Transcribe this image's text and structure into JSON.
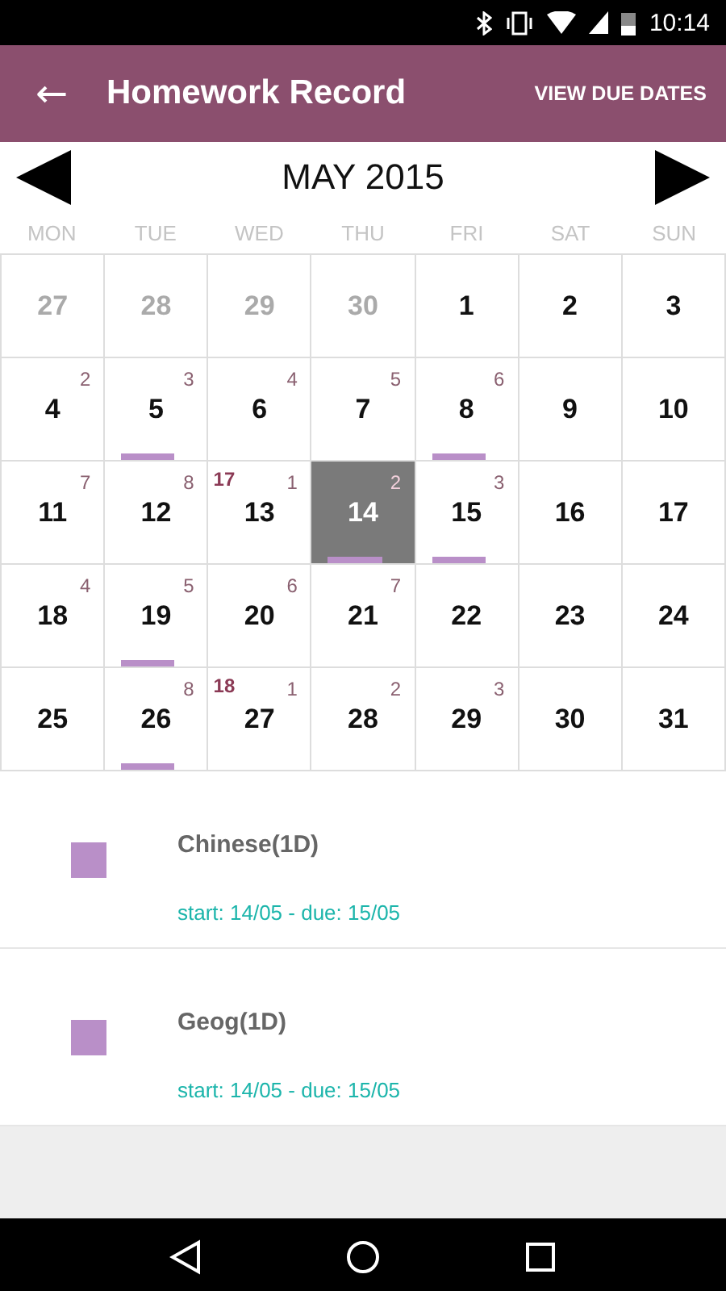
{
  "status_bar": {
    "time": "10:14"
  },
  "app_bar": {
    "back": "←",
    "title": "Homework Record",
    "action": "VIEW DUE DATES"
  },
  "calendar": {
    "month": "MAY 2015",
    "weekdays": [
      "MON",
      "TUE",
      "WED",
      "THU",
      "FRI",
      "SAT",
      "SUN"
    ],
    "days": [
      {
        "day": "27",
        "outside": true,
        "selected": false
      },
      {
        "day": "28",
        "outside": true,
        "selected": false
      },
      {
        "day": "29",
        "outside": true,
        "selected": false
      },
      {
        "day": "30",
        "outside": true,
        "selected": false
      },
      {
        "day": "1",
        "outside": false,
        "selected": false
      },
      {
        "day": "2",
        "outside": false,
        "selected": false
      },
      {
        "day": "3",
        "outside": false,
        "selected": false
      },
      {
        "day": "4",
        "outside": false,
        "selected": false,
        "count": "2"
      },
      {
        "day": "5",
        "outside": false,
        "selected": false,
        "count": "3",
        "bar": true
      },
      {
        "day": "6",
        "outside": false,
        "selected": false,
        "count": "4"
      },
      {
        "day": "7",
        "outside": false,
        "selected": false,
        "count": "5"
      },
      {
        "day": "8",
        "outside": false,
        "selected": false,
        "count": "6",
        "bar": true
      },
      {
        "day": "9",
        "outside": false,
        "selected": false
      },
      {
        "day": "10",
        "outside": false,
        "selected": false
      },
      {
        "day": "11",
        "outside": false,
        "selected": false,
        "count": "7"
      },
      {
        "day": "12",
        "outside": false,
        "selected": false,
        "count": "8"
      },
      {
        "day": "13",
        "outside": false,
        "selected": false,
        "count": "1",
        "week": "17"
      },
      {
        "day": "14",
        "outside": false,
        "selected": true,
        "count": "2",
        "bar": true
      },
      {
        "day": "15",
        "outside": false,
        "selected": false,
        "count": "3",
        "bar": true
      },
      {
        "day": "16",
        "outside": false,
        "selected": false
      },
      {
        "day": "17",
        "outside": false,
        "selected": false
      },
      {
        "day": "18",
        "outside": false,
        "selected": false,
        "count": "4"
      },
      {
        "day": "19",
        "outside": false,
        "selected": false,
        "count": "5",
        "bar": true
      },
      {
        "day": "20",
        "outside": false,
        "selected": false,
        "count": "6"
      },
      {
        "day": "21",
        "outside": false,
        "selected": false,
        "count": "7"
      },
      {
        "day": "22",
        "outside": false,
        "selected": false
      },
      {
        "day": "23",
        "outside": false,
        "selected": false
      },
      {
        "day": "24",
        "outside": false,
        "selected": false
      },
      {
        "day": "25",
        "outside": false,
        "selected": false
      },
      {
        "day": "26",
        "outside": false,
        "selected": false,
        "count": "8",
        "bar": true
      },
      {
        "day": "27",
        "outside": false,
        "selected": false,
        "count": "1",
        "week": "18"
      },
      {
        "day": "28",
        "outside": false,
        "selected": false,
        "count": "2"
      },
      {
        "day": "29",
        "outside": false,
        "selected": false,
        "count": "3"
      },
      {
        "day": "30",
        "outside": false,
        "selected": false
      },
      {
        "day": "31",
        "outside": false,
        "selected": false
      }
    ]
  },
  "homework": [
    {
      "subject": "Chinese(1D)",
      "dates": "start: 14/05 - due: 15/05",
      "color": "#b98fc8"
    },
    {
      "subject": "Geog(1D)",
      "dates": "start: 14/05 - due: 15/05",
      "color": "#b98fc8"
    }
  ]
}
